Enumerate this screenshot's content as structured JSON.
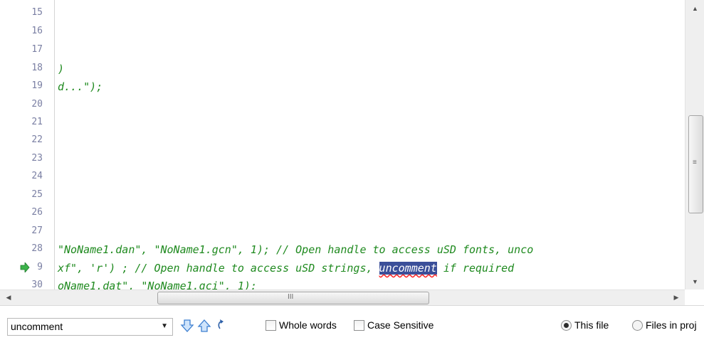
{
  "editor": {
    "line_numbers": [
      "15",
      "16",
      "17",
      "18",
      "19",
      "20",
      "21",
      "22",
      "23",
      "24",
      "25",
      "26",
      "27",
      "28",
      "29",
      "30"
    ],
    "code_lines": {
      "l18": ")",
      "l19": "d...\");",
      "l28": "\"NoName1.dan\", \"NoName1.gcn\", 1); // Open handle to access uSD fonts, unco",
      "l29_before": "xf\", 'r') ; // Open handle to access uSD strings, ",
      "l29_match": "uncomment",
      "l29_after": " if required",
      "l30": "oName1.dat\", \"NoName1.gci\", 1);"
    },
    "current_line_marker": "green-arrow-icon"
  },
  "scrollbars": {
    "vertical": {
      "up": "▲",
      "down": "▼",
      "grip": "≡"
    },
    "horizontal": {
      "left": "◀",
      "right": "▶",
      "grip": "III"
    }
  },
  "find_bar": {
    "search_value": "uncomment",
    "find_next_icon": "arrow-down-icon",
    "find_prev_icon": "arrow-up-icon",
    "refresh_icon": "refresh-icon",
    "whole_words_label": "Whole words",
    "case_sensitive_label": "Case Sensitive",
    "this_file_label": "This file",
    "files_in_project_label": "Files in proj",
    "scope_selected": "This file"
  },
  "colors": {
    "code_green": "#1f8a1f",
    "line_number": "#7a7fa3",
    "match_highlight": "#3b4f99",
    "arrow_blue": "#4a90d9"
  }
}
